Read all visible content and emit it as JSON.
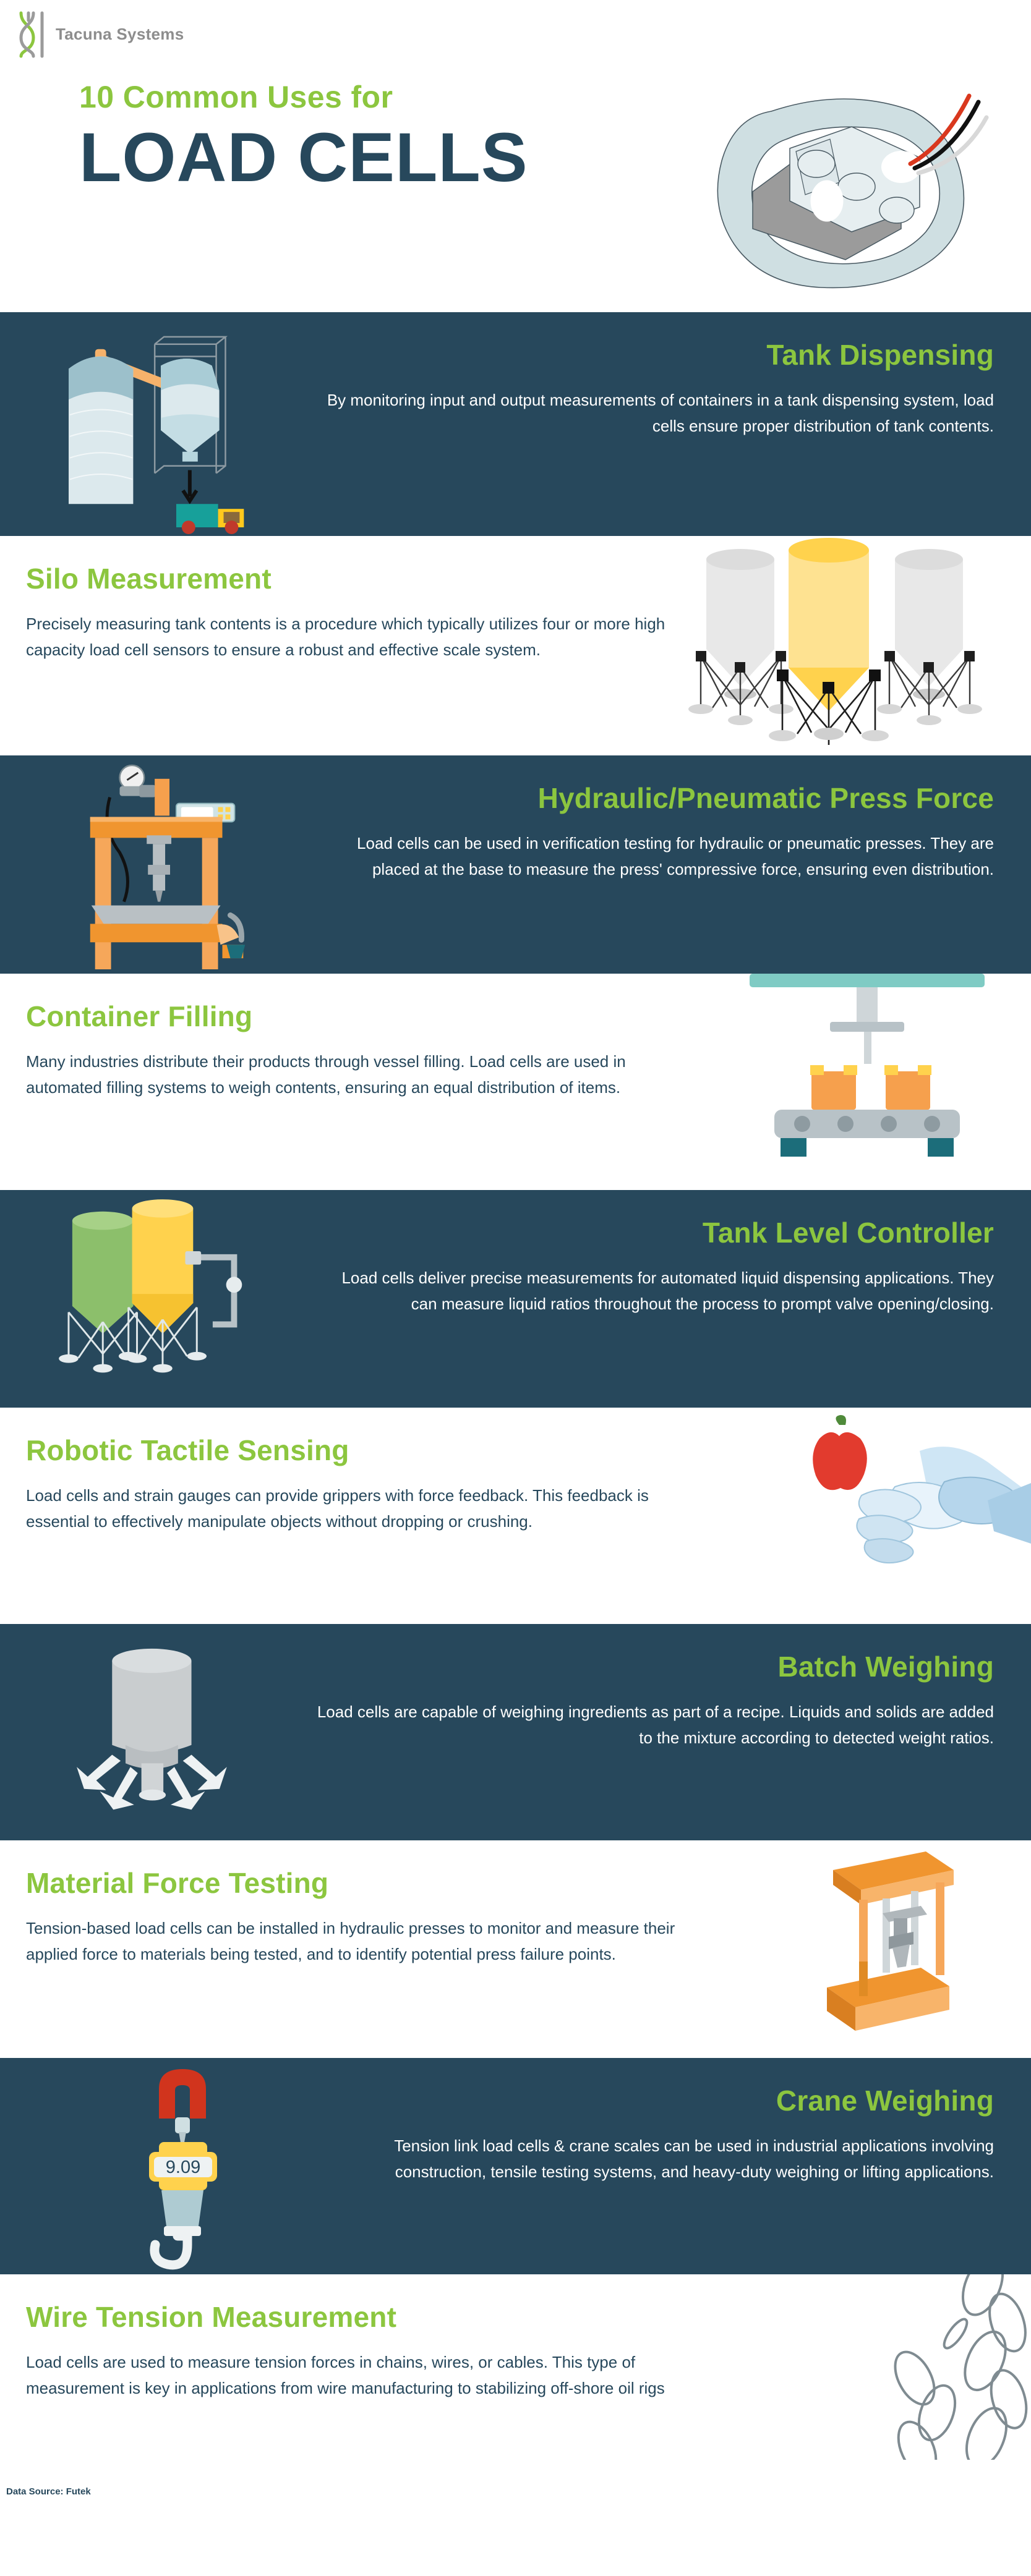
{
  "brand": {
    "name": "Tacuna Systems",
    "logo_icon": "tacuna-dna-logo-icon"
  },
  "hero": {
    "kicker": "10 Common Uses for",
    "title": "LOAD CELLS",
    "art_icon": "load-cell-illustration"
  },
  "colors": {
    "dark_navy": "#27485c",
    "green": "#8cc63f",
    "white": "#ffffff",
    "orange": "#f6a04d",
    "yellow": "#ffd24d",
    "teal": "#1f9e94",
    "red": "#d9381e",
    "grey": "#b8c4c9"
  },
  "sections": [
    {
      "index": 1,
      "theme": "dark",
      "title": "Tank Dispensing",
      "body": "By monitoring input and output measurements of containers in a tank dispensing system, load cells ensure proper distribution of tank contents.",
      "art_icon": "tank-dispensing-illustration"
    },
    {
      "index": 2,
      "theme": "light",
      "title": "Silo Measurement",
      "body": "Precisely measuring tank contents is a procedure which typically utilizes four or more high capacity load cell sensors to ensure a robust and effective scale system.",
      "art_icon": "silo-measurement-illustration"
    },
    {
      "index": 3,
      "theme": "dark",
      "title": "Hydraulic/Pneumatic Press Force",
      "body": "Load cells can be used in verification testing for hydraulic or pneumatic presses. They are placed at the base to measure the press' compressive force, ensuring even distribution.",
      "art_icon": "hydraulic-press-illustration"
    },
    {
      "index": 4,
      "theme": "light",
      "title": "Container Filling",
      "body": "Many industries distribute their products through vessel filling. Load cells are used in automated filling systems to weigh contents, ensuring an equal distribution of items.",
      "art_icon": "container-filling-illustration"
    },
    {
      "index": 5,
      "theme": "dark",
      "title": "Tank Level Controller",
      "body": "Load cells deliver precise measurements for automated liquid dispensing applications. They can measure liquid ratios throughout the process to prompt valve opening/closing.",
      "art_icon": "tank-level-controller-illustration"
    },
    {
      "index": 6,
      "theme": "light",
      "title": "Robotic Tactile Sensing",
      "body": "Load cells and strain gauges can provide grippers with force feedback. This feedback is essential to effectively manipulate objects without dropping or crushing.",
      "art_icon": "robotic-gripper-apple-illustration"
    },
    {
      "index": 7,
      "theme": "dark",
      "title": "Batch Weighing",
      "body": "Load cells are capable of weighing ingredients as part of a recipe. Liquids and solids are added to the mixture according to detected weight ratios.",
      "art_icon": "batch-weighing-vessel-illustration"
    },
    {
      "index": 8,
      "theme": "light",
      "title": "Material Force Testing",
      "body": "Tension-based load cells can be installed in hydraulic presses to monitor and measure their applied force to materials being tested, and to identify potential press failure points.",
      "art_icon": "material-force-testing-illustration"
    },
    {
      "index": 9,
      "theme": "dark",
      "title": "Crane Weighing",
      "body": "Tension link load cells & crane scales can be used in industrial applications involving construction, tensile testing systems, and heavy-duty weighing or lifting applications.",
      "art_icon": "crane-scale-illustration",
      "readout": "9.09"
    },
    {
      "index": 10,
      "theme": "light",
      "title": "Wire Tension Measurement",
      "body": "Load cells are used to measure tension forces in chains, wires, or cables. This type of measurement is key in applications from wire manufacturing to stabilizing off-shore oil rigs",
      "art_icon": "chain-links-illustration"
    }
  ],
  "footer": {
    "source": "Data Source: Futek"
  }
}
